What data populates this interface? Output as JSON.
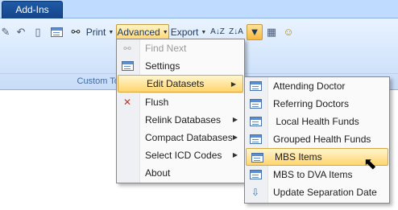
{
  "tabs": {
    "addins": "Add-Ins"
  },
  "toolbar": {
    "print": "Print",
    "advanced": "Advanced",
    "export": "Export",
    "group_label": "Custom Too"
  },
  "advanced_menu": [
    {
      "label": "Find Next",
      "disabled": true,
      "icon": "find-next-icon"
    },
    {
      "label": "Settings",
      "icon": "form-icon"
    },
    {
      "label": "Edit Datasets",
      "submenu": true,
      "highlighted": true
    },
    {
      "label": "Flush",
      "icon": "flush-icon"
    },
    {
      "label": "Relink Databases",
      "submenu": true
    },
    {
      "label": "Compact Databases",
      "submenu": true
    },
    {
      "label": "Select ICD Codes",
      "submenu": true
    },
    {
      "label": "About"
    }
  ],
  "datasets_menu": [
    {
      "label": "Attending Doctor",
      "icon": "form-icon"
    },
    {
      "label": "Referring Doctors",
      "icon": "form-icon"
    },
    {
      "label": " Local Health Funds",
      "icon": "form-icon"
    },
    {
      "label": "Grouped Health Funds",
      "icon": "form-icon"
    },
    {
      "label": "MBS Items",
      "icon": "form-icon",
      "highlighted": true
    },
    {
      "label": "MBS to DVA Items",
      "icon": "form-icon"
    },
    {
      "label": "Update Separation Date",
      "icon": "update-icon"
    }
  ],
  "colors": {
    "accent": "#ffd56e",
    "tab": "#15458a",
    "ribbon": "#d9e9fd"
  }
}
